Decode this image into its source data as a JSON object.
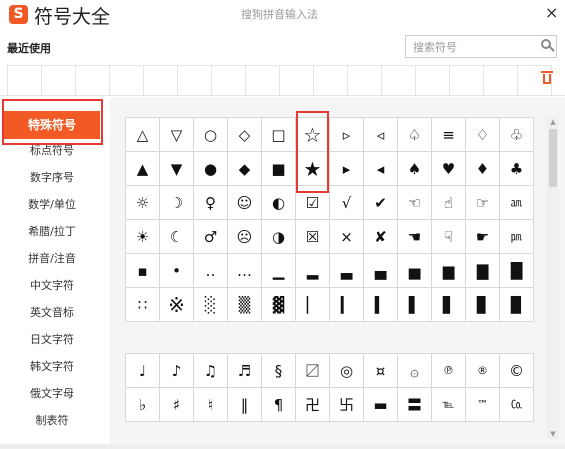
{
  "title_bar": {
    "logo_text": "S",
    "title": "符号大全",
    "subtitle": "搜狗拼音输入法",
    "close": "×"
  },
  "recent": {
    "label": "最近使用",
    "slots": 16
  },
  "search": {
    "placeholder": "搜索符号"
  },
  "sidebar": {
    "items": [
      {
        "label": "特殊符号",
        "active": true
      },
      {
        "label": "标点符号"
      },
      {
        "label": "数字序号"
      },
      {
        "label": "数学/单位"
      },
      {
        "label": "希腊/拉丁"
      },
      {
        "label": "拼音/注音"
      },
      {
        "label": "中文字符"
      },
      {
        "label": "英文音标"
      },
      {
        "label": "日文字符"
      },
      {
        "label": "韩文字符"
      },
      {
        "label": "俄文字母"
      },
      {
        "label": "制表符"
      }
    ]
  },
  "symbols_top": [
    [
      "△",
      "▽",
      "○",
      "◇",
      "□",
      "☆",
      "▹",
      "◃",
      "♤",
      "≡",
      "♢",
      "♧"
    ],
    [
      "▲",
      "▼",
      "●",
      "◆",
      "■",
      "★",
      "▸",
      "◂",
      "♠",
      "♥",
      "♦",
      "♣"
    ],
    [
      "☼",
      "☽",
      "♀",
      "☺",
      "◐",
      "☑",
      "√",
      "✔",
      "☜",
      "☝",
      "☞",
      "㏂"
    ],
    [
      "☀",
      "☾",
      "♂",
      "☹",
      "◑",
      "☒",
      "×",
      "✘",
      "☚",
      "☟",
      "☛",
      "㏘"
    ],
    [
      "▪",
      "•",
      "‥",
      "…",
      "▁",
      "▂",
      "▃",
      "▄",
      "▅",
      "▆",
      "▇",
      "█"
    ],
    [
      "∷",
      "※",
      "░",
      "▒",
      "▓",
      "▏",
      "▎",
      "▍",
      "▌",
      "▋",
      "▊",
      "▉"
    ]
  ],
  "symbols_bottom": [
    [
      "♩",
      "♪",
      "♫",
      "♬",
      "§",
      "〼",
      "◎",
      "¤",
      "۞",
      "℗",
      "®",
      "©"
    ],
    [
      "♭",
      "♯",
      "♮",
      "‖",
      "¶",
      "卍",
      "卐",
      "▬",
      "〓",
      "℡",
      "™",
      "㏇"
    ]
  ],
  "colors": {
    "accent": "#f15a24",
    "highlight": "#e53935"
  }
}
